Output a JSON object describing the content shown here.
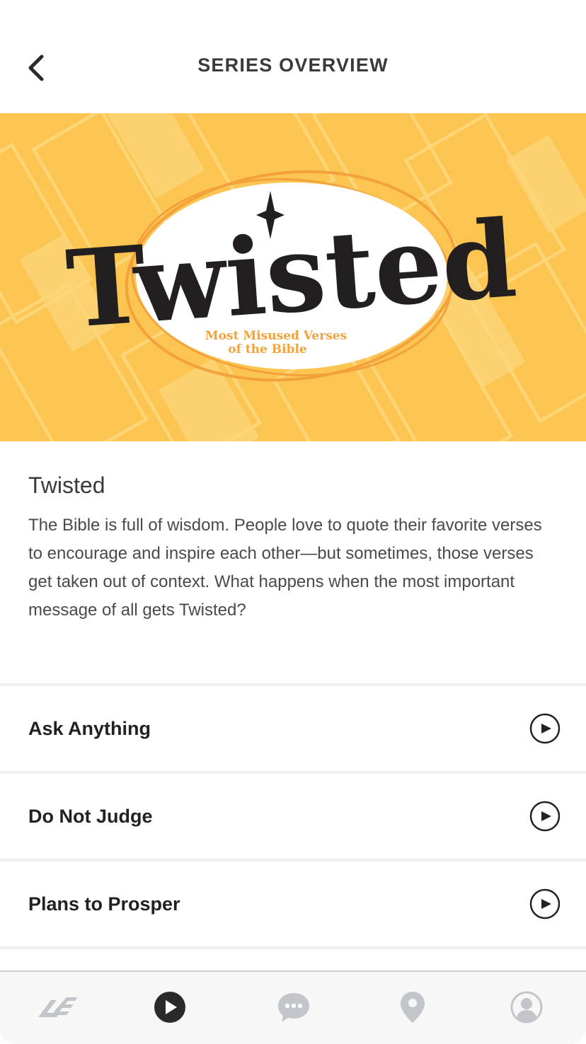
{
  "header": {
    "title": "SERIES OVERVIEW",
    "back_icon": "chevron-left-icon"
  },
  "hero": {
    "title_art": "Twisted",
    "subtitle_line1": "Most Misused Verses",
    "subtitle_line2": "of the Bible",
    "colors": {
      "background": "#FCC451",
      "ink": "#231F20",
      "accent": "#F3A23B",
      "oval": "#FFFFFF"
    }
  },
  "series": {
    "title": "Twisted",
    "description": "The Bible is full of wisdom. People love to quote their favorite verses to encourage and inspire each other—but sometimes, those verses get taken out of context. What happens when the most important message of all gets Twisted?"
  },
  "episodes": [
    {
      "title": "Ask Anything",
      "icon": "play-circle-icon"
    },
    {
      "title": "Do Not Judge",
      "icon": "play-circle-icon"
    },
    {
      "title": "Plans to Prosper",
      "icon": "play-circle-icon"
    }
  ],
  "tabbar": {
    "items": [
      {
        "name": "home",
        "icon": "church-logo-icon",
        "active": false
      },
      {
        "name": "watch",
        "icon": "play-icon",
        "active": true
      },
      {
        "name": "chat",
        "icon": "chat-bubble-icon",
        "active": false
      },
      {
        "name": "locations",
        "icon": "location-pin-icon",
        "active": false
      },
      {
        "name": "profile",
        "icon": "profile-icon",
        "active": false
      }
    ],
    "colors": {
      "active": "#2A2A2A",
      "inactive": "#C2C6CA"
    }
  }
}
